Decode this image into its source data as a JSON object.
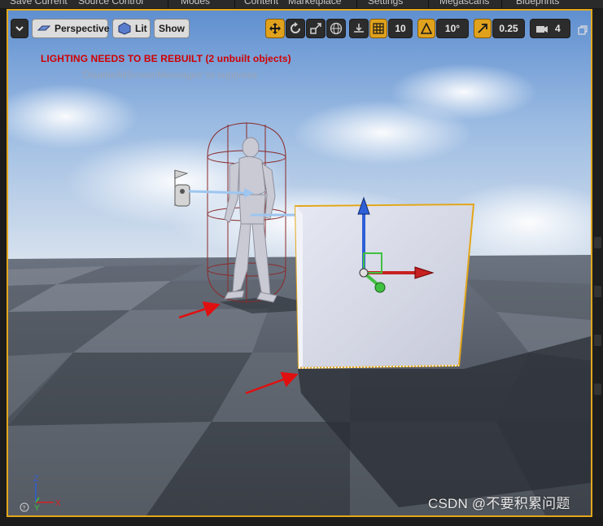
{
  "top_menu": {
    "items": [
      "Save Current",
      "Source Control",
      "Modes",
      "Content",
      "Marketplace",
      "Settings",
      "Megascans",
      "Blueprints"
    ]
  },
  "toolbar": {
    "perspective_label": "Perspective",
    "lit_label": "Lit",
    "show_label": "Show",
    "grid_snap_value": "10",
    "rotation_snap_value": "10°",
    "scale_snap_value": "0.25",
    "camera_speed_value": "4"
  },
  "messages": {
    "lighting_warning": "LIGHTING NEEDS TO BE REBUILT (2 unbuilt objects)",
    "suppress_hint": "'DisableAllScreenMessages' to suppress"
  },
  "axis_labels": {
    "x": "X",
    "y": "Y",
    "z": "Z"
  },
  "watermark": "CSDN @不要积累问题",
  "colors": {
    "selection_outline": "#e3a71b",
    "warning_text": "#d10000",
    "axis_x": "#d32020",
    "axis_y": "#40c040",
    "axis_z": "#2d5fd6",
    "annotation_arrow": "#e01010"
  }
}
